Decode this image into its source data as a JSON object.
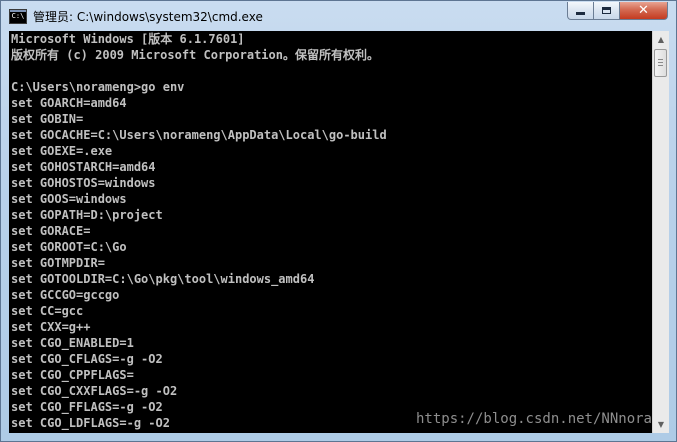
{
  "window": {
    "title": "管理员: C:\\windows\\system32\\cmd.exe",
    "icon_text": "C:\\",
    "controls": {
      "minimize_icon": "minimize-icon",
      "maximize_icon": "maximize-icon",
      "close_glyph": "✕"
    }
  },
  "console": {
    "lines": [
      "Microsoft Windows [版本 6.1.7601]",
      "版权所有 (c) 2009 Microsoft Corporation。保留所有权利。",
      "",
      "C:\\Users\\norameng>go env",
      "set GOARCH=amd64",
      "set GOBIN=",
      "set GOCACHE=C:\\Users\\norameng\\AppData\\Local\\go-build",
      "set GOEXE=.exe",
      "set GOHOSTARCH=amd64",
      "set GOHOSTOS=windows",
      "set GOOS=windows",
      "set GOPATH=D:\\project",
      "set GORACE=",
      "set GOROOT=C:\\Go",
      "set GOTMPDIR=",
      "set GOTOOLDIR=C:\\Go\\pkg\\tool\\windows_amd64",
      "set GCCGO=gccgo",
      "set CC=gcc",
      "set CXX=g++",
      "set CGO_ENABLED=1",
      "set CGO_CFLAGS=-g -O2",
      "set CGO_CPPFLAGS=",
      "set CGO_CXXFLAGS=-g -O2",
      "set CGO_FFLAGS=-g -O2",
      "set CGO_LDFLAGS=-g -O2"
    ],
    "watermark": "https://blog.csdn.net/NNnora"
  },
  "scrollbar": {
    "up_glyph": "▲",
    "down_glyph": "▼"
  },
  "colors": {
    "console_background": "#000000",
    "console_text": "#c0c0c0",
    "close_button": "#c43b20"
  }
}
